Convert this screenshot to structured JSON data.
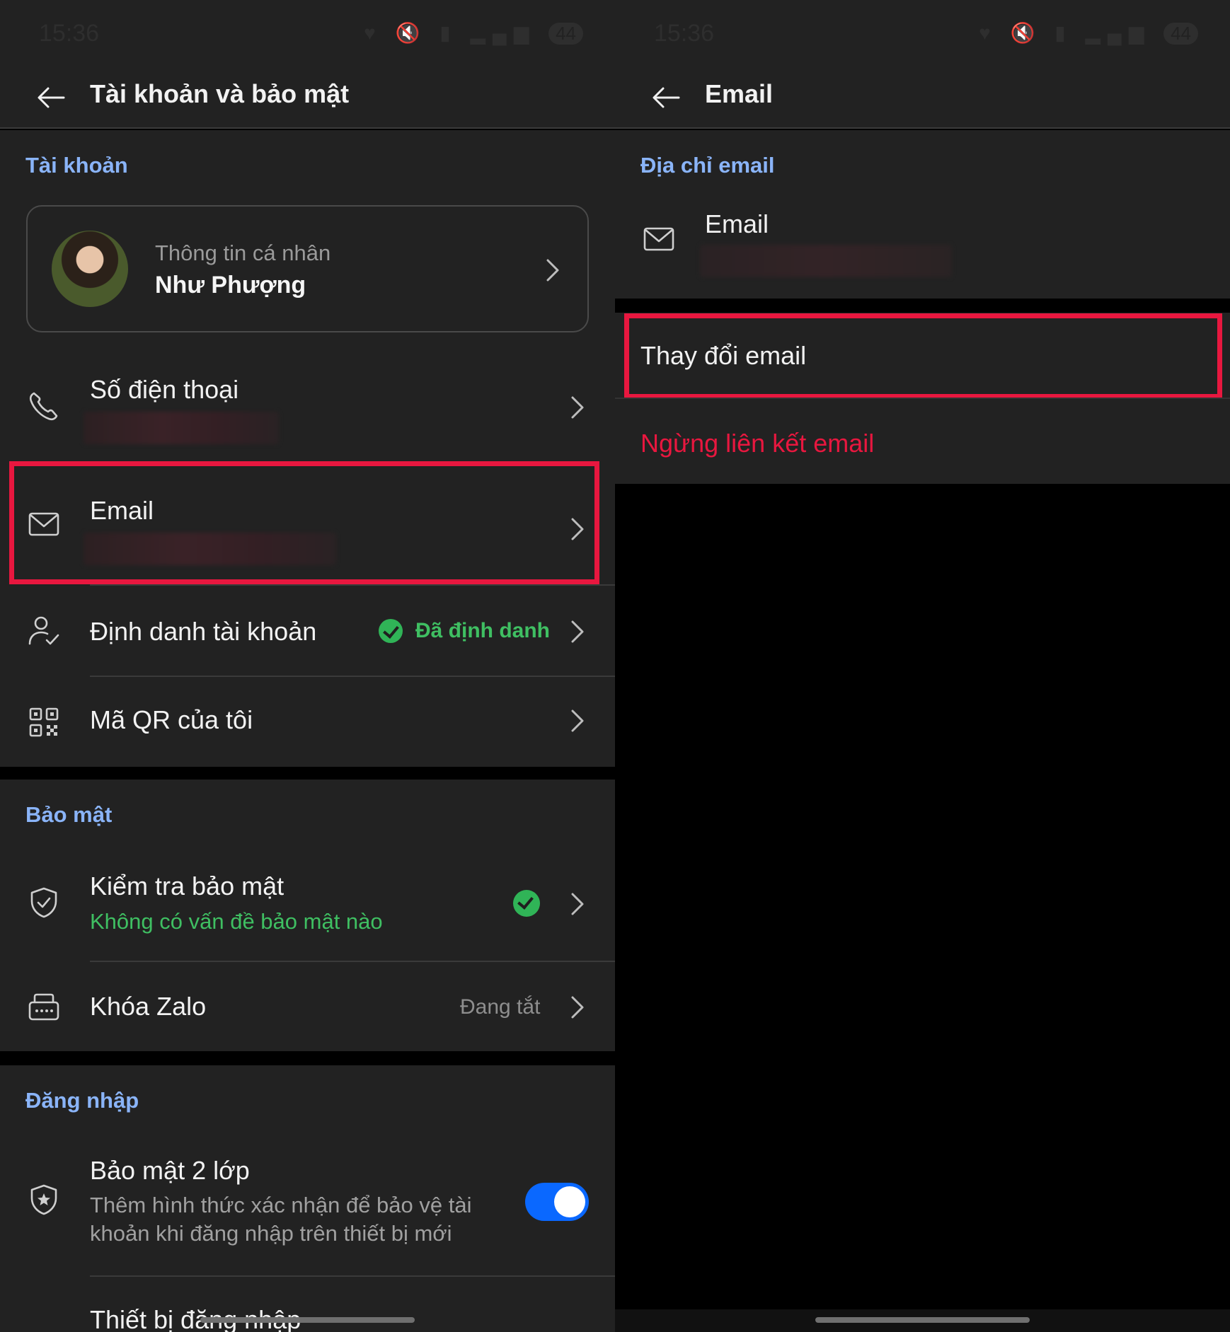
{
  "status": {
    "time": "15:36",
    "battery": "44"
  },
  "left": {
    "appbar": {
      "title": "Tài khoản và bảo mật"
    },
    "account_section": "Tài khoản",
    "profile": {
      "subtitle": "Thông tin cá nhân",
      "name": "Như Phượng"
    },
    "phone": {
      "label": "Số điện thoại"
    },
    "email": {
      "label": "Email"
    },
    "identity": {
      "label": "Định danh tài khoản",
      "status": "Đã định danh"
    },
    "qr": {
      "label": "Mã QR của tôi"
    },
    "security_section": "Bảo mật",
    "security_check": {
      "label": "Kiểm tra bảo mật",
      "status": "Không có vấn đề bảo mật nào"
    },
    "zalo_lock": {
      "label": "Khóa Zalo",
      "status": "Đang tắt"
    },
    "login_section": "Đăng nhập",
    "two_factor": {
      "label": "Bảo mật 2 lớp",
      "desc1": "Thêm hình thức xác nhận để bảo vệ tài",
      "desc2": "khoản khi đăng nhập trên thiết bị mới",
      "enabled": true
    },
    "devices": {
      "label": "Thiết bị đăng nhập"
    }
  },
  "right": {
    "appbar": {
      "title": "Email"
    },
    "section_title": "Địa chỉ email",
    "email_label": "Email",
    "change_email": "Thay đổi email",
    "unlink_email": "Ngừng liên kết email"
  },
  "colors": {
    "accent_blue": "#8ab4f8",
    "success_green": "#3fbf62",
    "danger_red": "#e8173f",
    "toggle_blue": "#0a68ff"
  }
}
